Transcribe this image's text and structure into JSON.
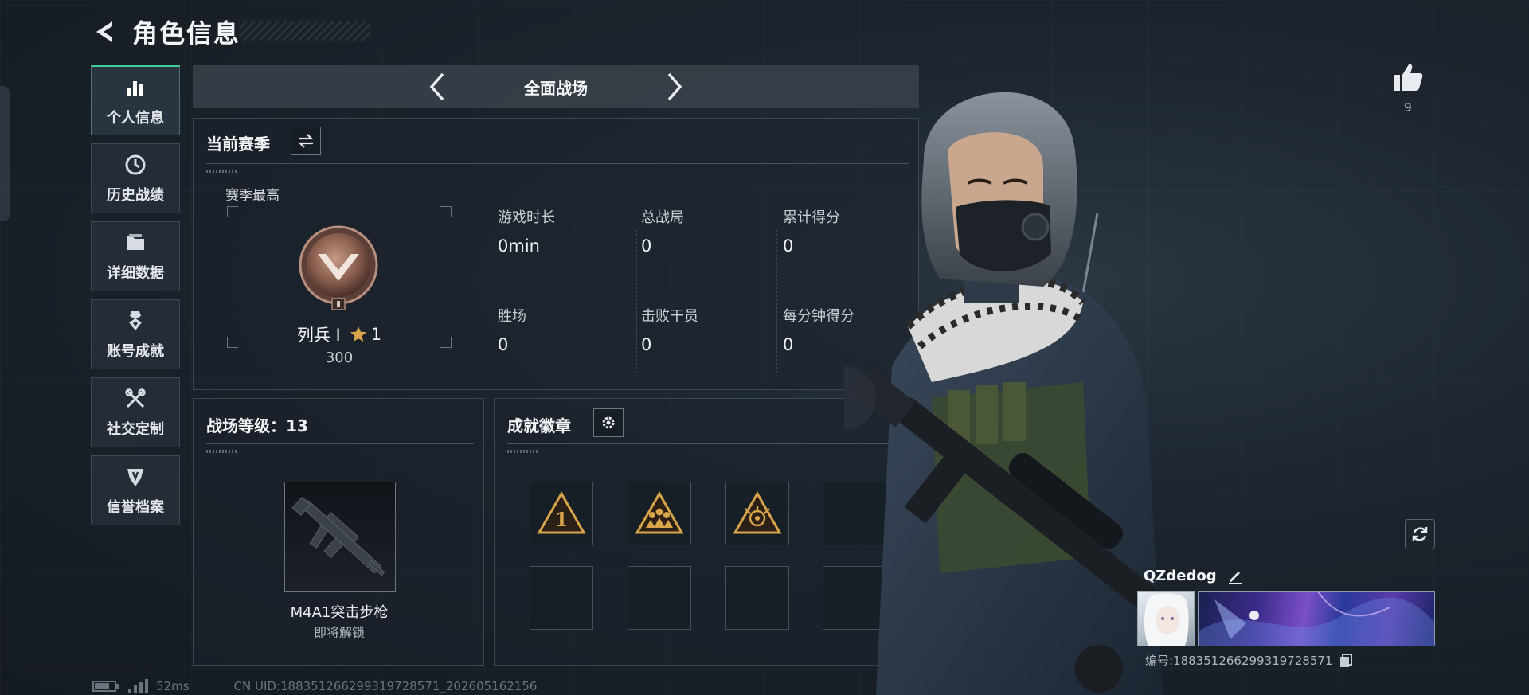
{
  "header": {
    "title": "角色信息"
  },
  "nav": {
    "items": [
      {
        "label": "个人信息",
        "icon": "bar-chart-icon"
      },
      {
        "label": "历史战绩",
        "icon": "history-clock-icon"
      },
      {
        "label": "详细数据",
        "icon": "folder-icon"
      },
      {
        "label": "账号成就",
        "icon": "achievement-medal-icon"
      },
      {
        "label": "社交定制",
        "icon": "wrench-tools-icon"
      },
      {
        "label": "信誉档案",
        "icon": "credit-shield-icon"
      }
    ]
  },
  "mode": {
    "title": "全面战场"
  },
  "season": {
    "title": "当前赛季",
    "best_label": "赛季最高",
    "rank_name": "列兵 Ⅰ",
    "stars": "1",
    "score": "300",
    "stats": [
      {
        "label": "游戏时长",
        "value": "0min"
      },
      {
        "label": "总战局",
        "value": "0"
      },
      {
        "label": "累计得分",
        "value": "0"
      },
      {
        "label": "胜场",
        "value": "0"
      },
      {
        "label": "击败干员",
        "value": "0"
      },
      {
        "label": "每分钟得分",
        "value": "0"
      }
    ]
  },
  "battlefield_level": {
    "title": "战场等级：13",
    "weapon_name": "M4A1突击步枪",
    "weapon_status": "即将解锁"
  },
  "badges": {
    "title": "成就徽章",
    "slots": [
      "badge-rank-one",
      "badge-squad",
      "badge-emblem",
      "empty",
      "empty",
      "empty",
      "empty",
      "empty"
    ]
  },
  "profile": {
    "likes": "9",
    "name": "QZdedog",
    "id_line": "编号:1883512662993197​28571"
  },
  "statusbar": {
    "ping": "52ms",
    "uid": "CN UID:188351266299319728571_202605162156"
  },
  "colors": {
    "accent": "#3fd29a",
    "gold": "#d8a54a",
    "badge_bg": "#2b2016"
  }
}
